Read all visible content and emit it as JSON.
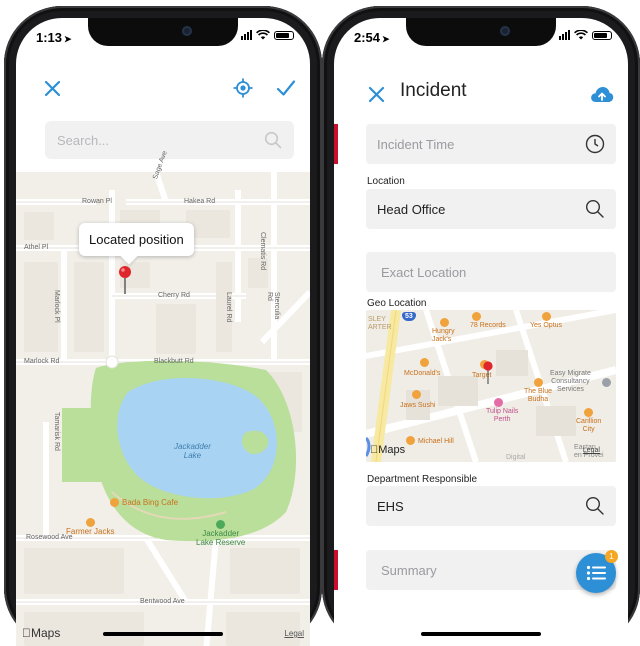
{
  "left_phone": {
    "status": {
      "time": "1:13"
    },
    "toolbar": {
      "close_icon": "close-icon",
      "locate_icon": "crosshair-icon",
      "confirm_icon": "check-icon"
    },
    "search": {
      "placeholder": "Search...",
      "value": ""
    },
    "map": {
      "tooltip": "Located position",
      "streets": {
        "rowan": "Rowan Pl",
        "hakea": "Hakea Rd",
        "athel": "Athel Pl",
        "cherry": "Cherry Rd",
        "blackbutt": "Blackbutt Rd",
        "marlock_rd": "Marlock Rd",
        "marlock_pl": "Marlock Pl",
        "clematis": "Clematis Rd",
        "laurel": "Laurel Rd",
        "tamarisk": "Tamarisk Rd",
        "sterculia": "Sterculia Rd",
        "rosewood": "Rosewood Ave",
        "bentwood": "Bentwood Ave",
        "sage": "Sage Ave"
      },
      "lake": "Jackadder\nLake",
      "poi_cafe": "Bada Bing Cafe",
      "poi_farmer": "Farmer Jacks",
      "poi_reserve": "Jackadder\nLake Reserve",
      "attribution": "Maps",
      "legal": "Legal"
    }
  },
  "right_phone": {
    "status": {
      "time": "2:54"
    },
    "header": {
      "title": "Incident",
      "close_icon": "close-icon",
      "upload_icon": "cloud-upload-icon"
    },
    "fields": {
      "incident_time": {
        "placeholder": "Incident Time"
      },
      "location": {
        "label": "Location",
        "value": "Head Office"
      },
      "exact_location": {
        "placeholder": "Exact Location"
      },
      "geo_location": {
        "label": "Geo Location"
      },
      "department": {
        "label": "Department Responsible",
        "value": "EHS"
      },
      "summary": {
        "placeholder": "Summary"
      }
    },
    "geo_map": {
      "route": "53",
      "pois": {
        "hungry": "Hungry\nJack's",
        "records": "78 Records",
        "optus": "Yes Optus",
        "mcdonalds": "McDonald's",
        "target": "Target",
        "jaws": "Jaws Sushi",
        "tulip": "Tulip Nails\nPerth",
        "budha": "The Blue\nBudha",
        "easy": "Easy Migrate\nConsultancy\nServices",
        "carillion": "Carillion\nCity",
        "michael": "Michael Hill",
        "digital": "Digital",
        "slley": "SLEY\nARTER",
        "legal": "Legal",
        "eastern": "Eastan\nen Provei"
      },
      "attribution": "Maps"
    },
    "fab": {
      "badge": "1",
      "icon": "list-icon"
    }
  },
  "colors": {
    "accent": "#2d8fd5",
    "required": "#c8102e",
    "park": "#b9df9a",
    "water": "#a9d3f2"
  }
}
